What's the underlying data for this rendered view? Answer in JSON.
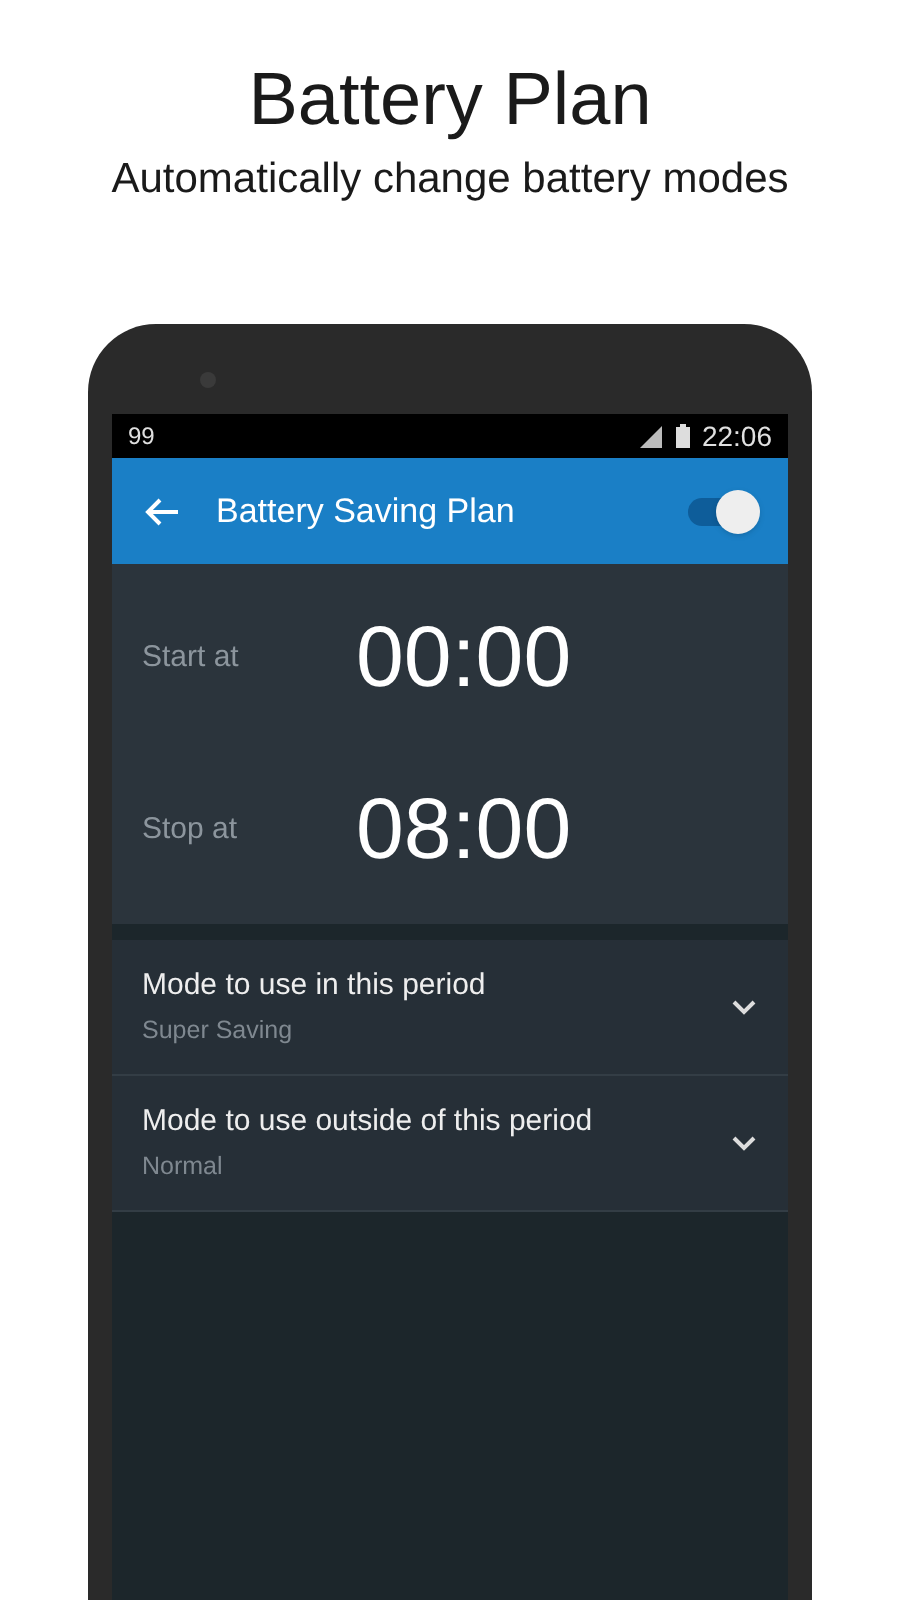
{
  "headline": "Battery Plan",
  "subtitle": "Automatically change battery modes",
  "status_bar": {
    "notification": "99",
    "time": "22:06"
  },
  "app_bar": {
    "title": "Battery Saving Plan",
    "switch_on": true
  },
  "times": [
    {
      "label": "Start at",
      "value": "00:00"
    },
    {
      "label": "Stop at",
      "value": "08:00"
    }
  ],
  "modes": [
    {
      "title": "Mode to use in this period",
      "value": "Super Saving"
    },
    {
      "title": "Mode to use outside of this period",
      "value": "Normal"
    }
  ]
}
